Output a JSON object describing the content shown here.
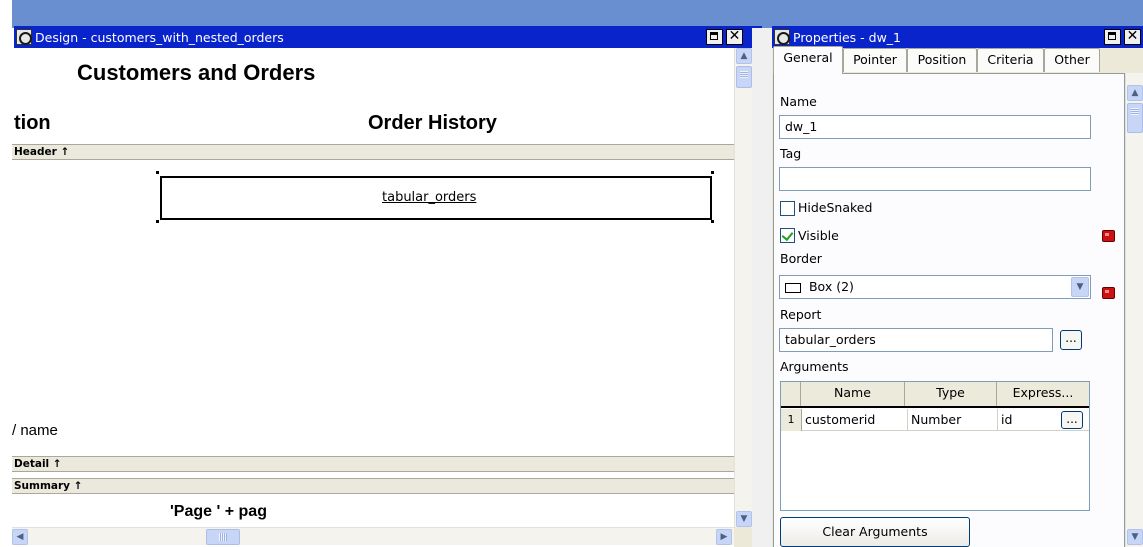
{
  "design_window": {
    "title": "Design - customers_with_nested_orders",
    "report_title": "Customers and Orders",
    "header_left": "tion",
    "header_right": "Order History",
    "header_band": "Header ↑",
    "nested_report_name": "tabular_orders",
    "detail_field_label": "/ name",
    "detail_band": "Detail ↑",
    "summary_band": "Summary ↑",
    "page_expression": "'Page ' + pag"
  },
  "properties_window": {
    "title": "Properties - dw_1",
    "tabs": [
      "General",
      "Pointer",
      "Position",
      "Criteria",
      "Other"
    ],
    "active_tab": "General",
    "name_label": "Name",
    "name_value": "dw_1",
    "tag_label": "Tag",
    "tag_value": "",
    "hide_snaked_label": "HideSnaked",
    "hide_snaked_checked": false,
    "visible_label": "Visible",
    "visible_checked": true,
    "border_label": "Border",
    "border_value": "Box (2)",
    "report_label": "Report",
    "report_value": "tabular_orders",
    "ellipsis": "...",
    "arguments_label": "Arguments",
    "arguments_columns": [
      "Name",
      "Type",
      "Express..."
    ],
    "arguments_rows": [
      {
        "index": "1",
        "name": "customerid",
        "type": "Number",
        "expression": "id"
      }
    ],
    "clear_button": "Clear Arguments"
  },
  "colors": {
    "titlebar": "#0a24cc",
    "band": "#ebe9dd",
    "checkmark": "#21a121",
    "scroll": "#c7d5f6"
  },
  "icons": [
    "app-icon",
    "maximize-icon",
    "close-icon",
    "scroll-up-icon",
    "scroll-down-icon",
    "scroll-left-icon",
    "scroll-right-icon",
    "expression-icon",
    "dropdown-arrow-icon",
    "border-box-icon"
  ]
}
